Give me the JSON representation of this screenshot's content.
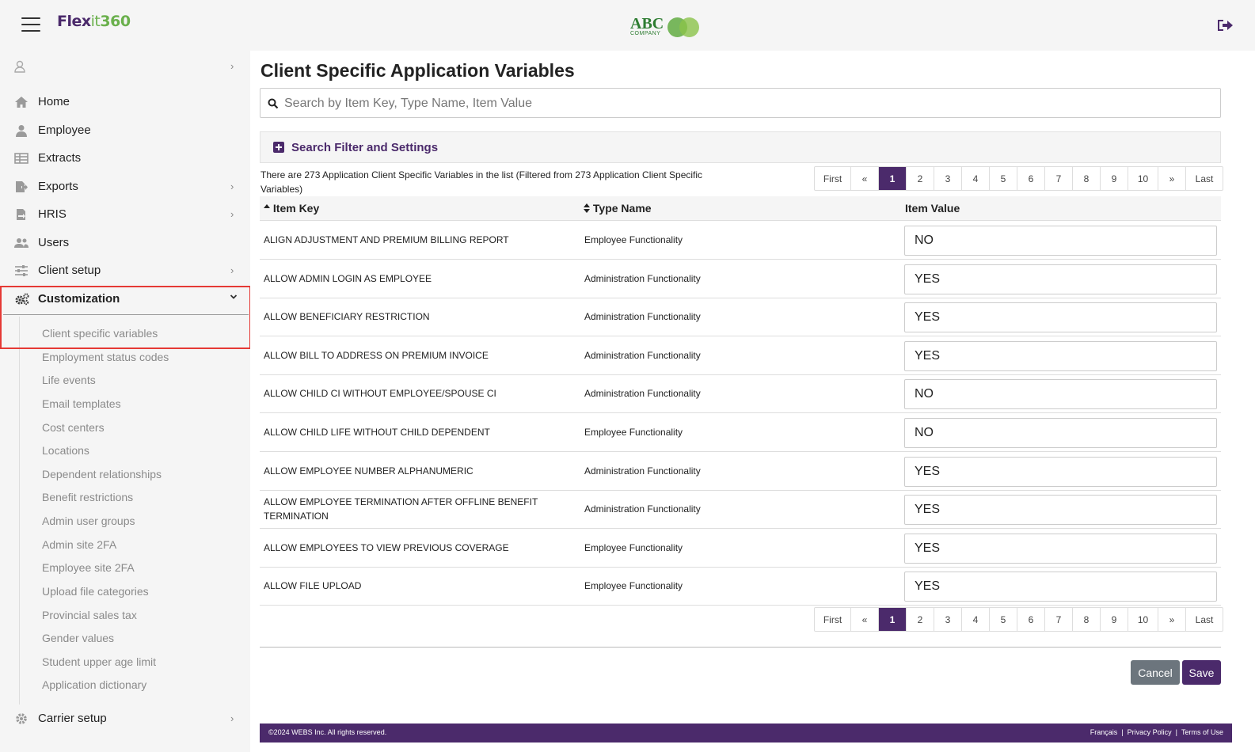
{
  "header": {
    "brand_part1": "Flex",
    "brand_part2": "it",
    "brand_part3": "360",
    "center_logo_text": "ABC",
    "center_logo_subtext": "COMPANY"
  },
  "sidebar": {
    "items": [
      {
        "label": "Home",
        "icon": "home-icon"
      },
      {
        "label": "Employee",
        "icon": "person-icon"
      },
      {
        "label": "Extracts",
        "icon": "table-icon"
      },
      {
        "label": "Exports",
        "icon": "export-icon"
      },
      {
        "label": "HRIS",
        "icon": "hris-icon"
      },
      {
        "label": "Users",
        "icon": "users-icon"
      },
      {
        "label": "Client setup",
        "icon": "sliders-icon"
      },
      {
        "label": "Customization",
        "icon": "gears-icon"
      },
      {
        "label": "Carrier setup",
        "icon": "gear-icon"
      }
    ],
    "sub_items": [
      "Client specific variables",
      "Employment status codes",
      "Life events",
      "Email templates",
      "Cost centers",
      "Locations",
      "Dependent relationships",
      "Benefit restrictions",
      "Admin user groups",
      "Admin site 2FA",
      "Employee site 2FA",
      "Upload file categories",
      "Provincial sales tax",
      "Gender values",
      "Student upper age limit",
      "Application dictionary"
    ]
  },
  "main": {
    "title": "Client Specific Application Variables",
    "search_placeholder": "Search by Item Key, Type Name, Item Value",
    "filter_label": "Search Filter and Settings",
    "summary": "There are 273 Application Client Specific Variables in the list (Filtered from 273 Application Client Specific Variables)",
    "pagination": [
      "First",
      "«",
      "1",
      "2",
      "3",
      "4",
      "5",
      "6",
      "7",
      "8",
      "9",
      "10",
      "»",
      "Last"
    ],
    "active_page": "1",
    "columns": {
      "item_key": "Item Key",
      "type_name": "Type Name",
      "item_value": "Item Value"
    },
    "rows": [
      {
        "key": "ALIGN ADJUSTMENT AND PREMIUM BILLING REPORT",
        "type": "Employee Functionality",
        "value": "NO"
      },
      {
        "key": "ALLOW ADMIN LOGIN AS EMPLOYEE",
        "type": "Administration Functionality",
        "value": "YES"
      },
      {
        "key": "ALLOW BENEFICIARY RESTRICTION",
        "type": "Administration Functionality",
        "value": "YES"
      },
      {
        "key": "ALLOW BILL TO ADDRESS ON PREMIUM INVOICE",
        "type": "Administration Functionality",
        "value": "YES"
      },
      {
        "key": "ALLOW CHILD CI WITHOUT EMPLOYEE/SPOUSE CI",
        "type": "Administration Functionality",
        "value": "NO"
      },
      {
        "key": "ALLOW CHILD LIFE WITHOUT CHILD DEPENDENT",
        "type": "Employee Functionality",
        "value": "NO"
      },
      {
        "key": "ALLOW EMPLOYEE NUMBER ALPHANUMERIC",
        "type": "Administration Functionality",
        "value": "YES"
      },
      {
        "key": "ALLOW EMPLOYEE TERMINATION AFTER OFFLINE BENEFIT TERMINATION",
        "type": "Administration Functionality",
        "value": "YES"
      },
      {
        "key": "ALLOW EMPLOYEES TO VIEW PREVIOUS COVERAGE",
        "type": "Employee Functionality",
        "value": "YES"
      },
      {
        "key": "ALLOW FILE UPLOAD",
        "type": "Employee Functionality",
        "value": "YES"
      }
    ],
    "cancel_label": "Cancel",
    "save_label": "Save"
  },
  "footer": {
    "copyright": "©2024 WEBS Inc. All rights reserved.",
    "lang_link": "Français",
    "privacy_link": "Privacy Policy",
    "terms_link": "Terms of Use"
  },
  "colors": {
    "brand_purple": "#4b2a6b",
    "brand_green": "#6ab04c",
    "highlight_red": "#e53935"
  }
}
